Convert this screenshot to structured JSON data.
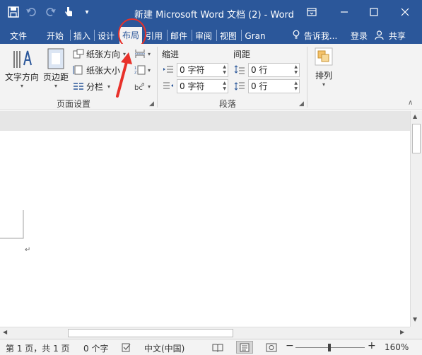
{
  "window": {
    "title": "新建 Microsoft Word 文档 (2) - Word"
  },
  "qat": {
    "save_icon": "save-icon",
    "undo_icon": "undo-icon",
    "redo_icon": "redo-icon",
    "touch_icon": "touch-mode-icon",
    "customize_icon": "customize-qat-icon"
  },
  "tabs": [
    {
      "label": "文件"
    },
    {
      "label": "开始"
    },
    {
      "label": "插入"
    },
    {
      "label": "设计"
    },
    {
      "label": "布局"
    },
    {
      "label": "引用"
    },
    {
      "label": "邮件"
    },
    {
      "label": "审阅"
    },
    {
      "label": "视图"
    },
    {
      "label": "Gran"
    }
  ],
  "tellme": {
    "label": "告诉我..."
  },
  "signin": {
    "label": "登录"
  },
  "share": {
    "label": "共享"
  },
  "ribbon": {
    "page_setup": {
      "text_direction": "文字方向",
      "margins": "页边距",
      "orientation": "纸张方向",
      "size": "纸张大小",
      "columns": "分栏",
      "group_label": "页面设置"
    },
    "paragraph": {
      "indent_label": "缩进",
      "spacing_label": "间距",
      "indent_left_value": "0 字符",
      "indent_right_value": "0 字符",
      "spacing_before_value": "0 行",
      "spacing_after_value": "0 行",
      "group_label": "段落"
    },
    "arrange": {
      "label": "排列"
    }
  },
  "document": {
    "paragraph_mark": "↵"
  },
  "status": {
    "page": "第 1 页，共 1 页",
    "words": "0 个字",
    "language": "中文(中国)",
    "zoom": "160%",
    "zoom_minus": "−",
    "zoom_plus": "+"
  },
  "colors": {
    "brand": "#2b579a",
    "annotation": "#e8312a"
  }
}
